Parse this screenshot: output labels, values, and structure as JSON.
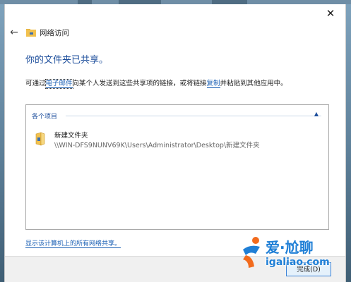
{
  "window": {
    "close_glyph": "✕"
  },
  "nav": {
    "back_glyph": "←",
    "title": "网络访问"
  },
  "heading": "你的文件夹已共享。",
  "description": {
    "part1": "可通过",
    "email_link": "电子邮件",
    "part2": "向某个人发送到这些共享项的链接，或将链接",
    "copy_link": "复制",
    "part3": "并粘贴到其他应用中。"
  },
  "list": {
    "group_label": "各个项目",
    "collapse_glyph": "▲",
    "items": [
      {
        "name": "新建文件夹",
        "path": "\\\\WIN-DFS9NUNV69K\\Users\\Administrator\\Desktop\\新建文件夹"
      }
    ]
  },
  "show_all_link": "显示该计算机上的所有网络共享。",
  "footer": {
    "done_label": "完成(D)"
  },
  "watermark": {
    "cn": "爱·尬聊",
    "url": "igaliao.com"
  },
  "icons": {
    "back": "back-arrow-icon",
    "network_folder": "network-folder-icon",
    "folder": "folder-icon",
    "close": "close-icon",
    "collapse": "chevron-up-icon"
  },
  "colors": {
    "accent": "#1e4f9c",
    "link": "#1a5fb4",
    "folder": "#f2c14e"
  }
}
